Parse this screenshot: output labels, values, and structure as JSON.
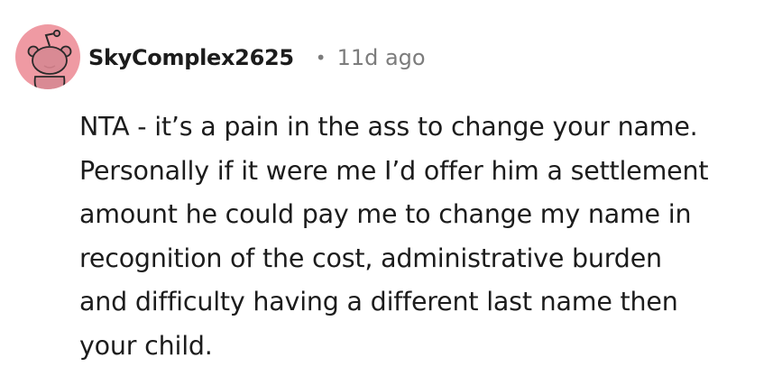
{
  "comment": {
    "avatar_icon": "reddit-snoo-avatar-icon",
    "avatar_color": "#ef9aa3",
    "username": "SkyComplex2625",
    "separator": "•",
    "timestamp": "11d ago",
    "body_lines": [
      "NTA - it’s a pain in the ass to change your name.",
      "Personally if it were me I’d offer him a settlement",
      "amount he could pay me to change my name in",
      "recognition of the cost, administrative burden",
      "and difficulty having a different last name then",
      "your child."
    ]
  }
}
